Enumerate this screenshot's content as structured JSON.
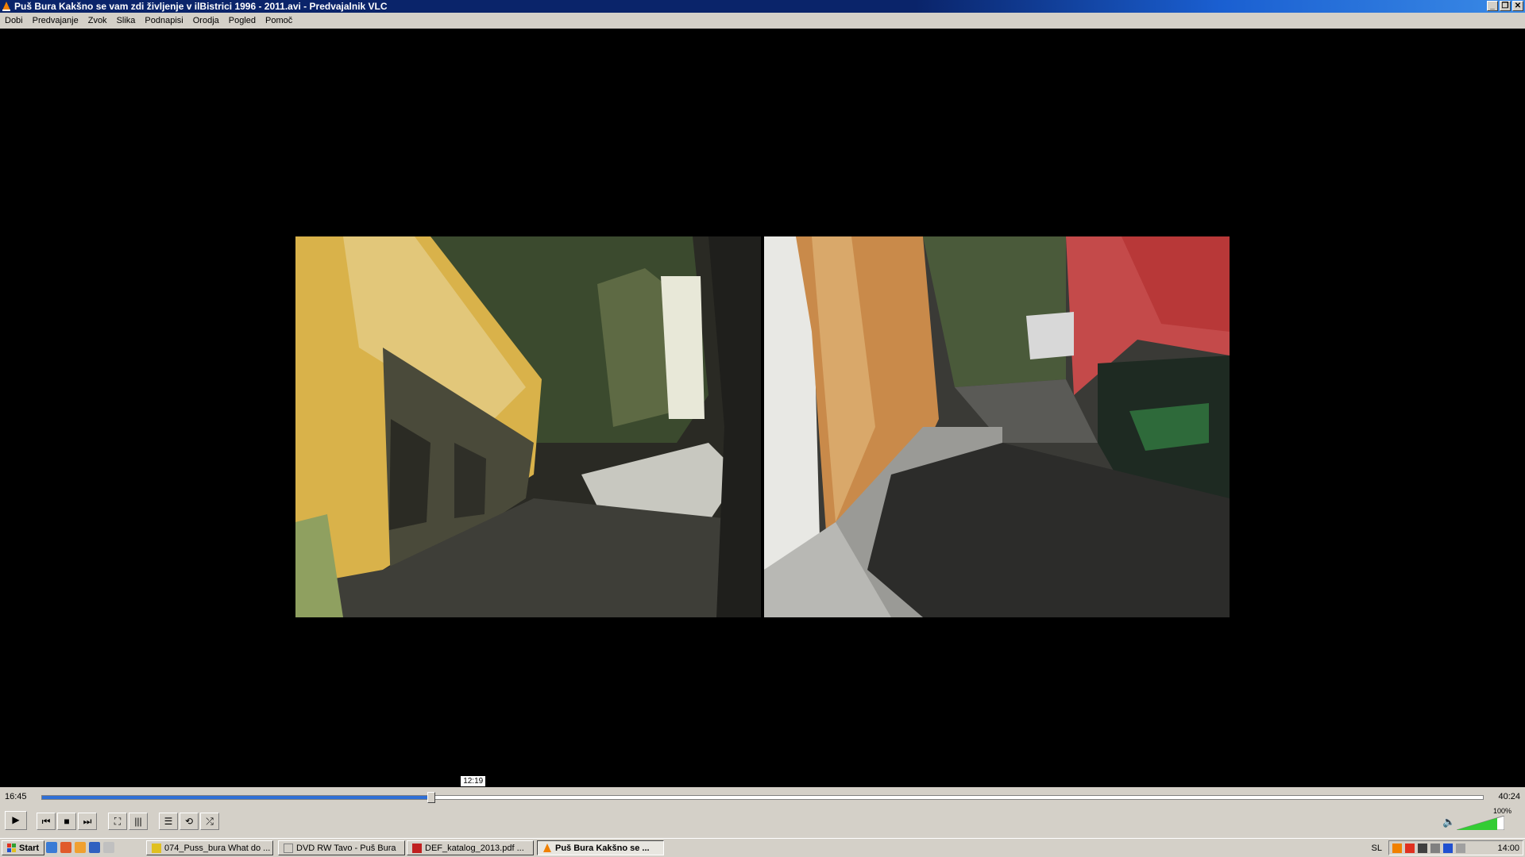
{
  "window": {
    "title": "Puš Bura Kakšno se vam zdi življenje v ilBistrici 1996 - 2011.avi - Predvajalnik VLC",
    "minimize": "_",
    "restore": "❐",
    "close": "✕"
  },
  "menu": [
    "Dobi",
    "Predvajanje",
    "Zvok",
    "Slika",
    "Podnapisi",
    "Orodja",
    "Pogled",
    "Pomoč"
  ],
  "playback": {
    "elapsed": "16:45",
    "total": "40:24",
    "tooltip": "12:19",
    "progress": 0.27
  },
  "controls": {
    "play": "▶",
    "prev": "⏮",
    "stop": "■",
    "next": "⏭",
    "fullscreen": "⛶",
    "extended": "|||",
    "playlist": "☰",
    "loop": "⟲",
    "random": "⤮",
    "volume_icon": "🔈",
    "volume_mark": "100%",
    "volume_level": 0.85
  },
  "taskbar": {
    "start": "Start",
    "tasks": [
      {
        "label": "074_Puss_bura What do ..."
      },
      {
        "label": "DVD RW Tavo - Puš Bura"
      },
      {
        "label": "DEF_katalog_2013.pdf ..."
      },
      {
        "label": "Puš Bura Kakšno se ..."
      }
    ],
    "lang": "SL",
    "clock": "14:00"
  },
  "colors": {
    "accent": "#2f6fd6",
    "titlebar": "#0a246a",
    "chrome": "#d4d0c8"
  }
}
